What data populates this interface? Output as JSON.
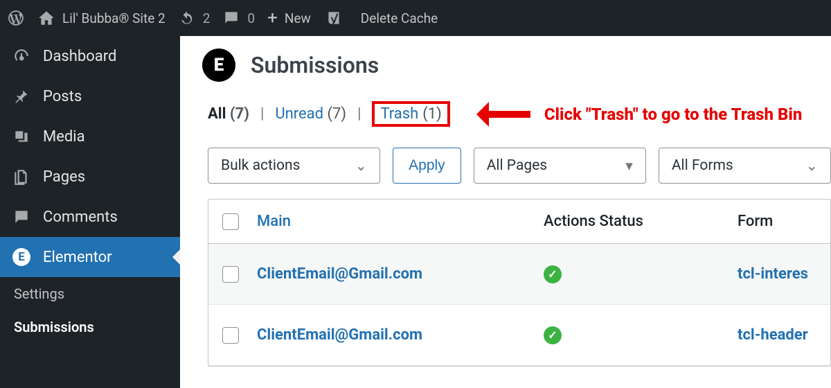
{
  "adminbar": {
    "site_name": "Lil' Bubba® Site 2",
    "refresh_count": "2",
    "comments_count": "0",
    "new_label": "New",
    "delete_cache": "Delete Cache"
  },
  "sidebar": {
    "items": [
      {
        "label": "Dashboard"
      },
      {
        "label": "Posts"
      },
      {
        "label": "Media"
      },
      {
        "label": "Pages"
      },
      {
        "label": "Comments"
      },
      {
        "label": "Elementor"
      }
    ],
    "submenu": [
      {
        "label": "Settings"
      },
      {
        "label": "Submissions"
      }
    ]
  },
  "page": {
    "title": "Submissions",
    "logo_glyph": "E"
  },
  "filters": {
    "all_label": "All",
    "all_count": "(7)",
    "unread_label": "Unread",
    "unread_count": "(7)",
    "trash_label": "Trash",
    "trash_count": "(1)"
  },
  "callout": "Click \"Trash\" to go to the Trash Bin",
  "controls": {
    "bulk": "Bulk actions",
    "apply": "Apply",
    "pages": "All Pages",
    "forms": "All Forms"
  },
  "table": {
    "headers": {
      "main": "Main",
      "status": "Actions Status",
      "form": "Form"
    },
    "rows": [
      {
        "main": "ClientEmail@Gmail.com",
        "status": "ok",
        "form": "tcl-interes"
      },
      {
        "main": "ClientEmail@Gmail.com",
        "status": "ok",
        "form": "tcl-header"
      }
    ]
  }
}
